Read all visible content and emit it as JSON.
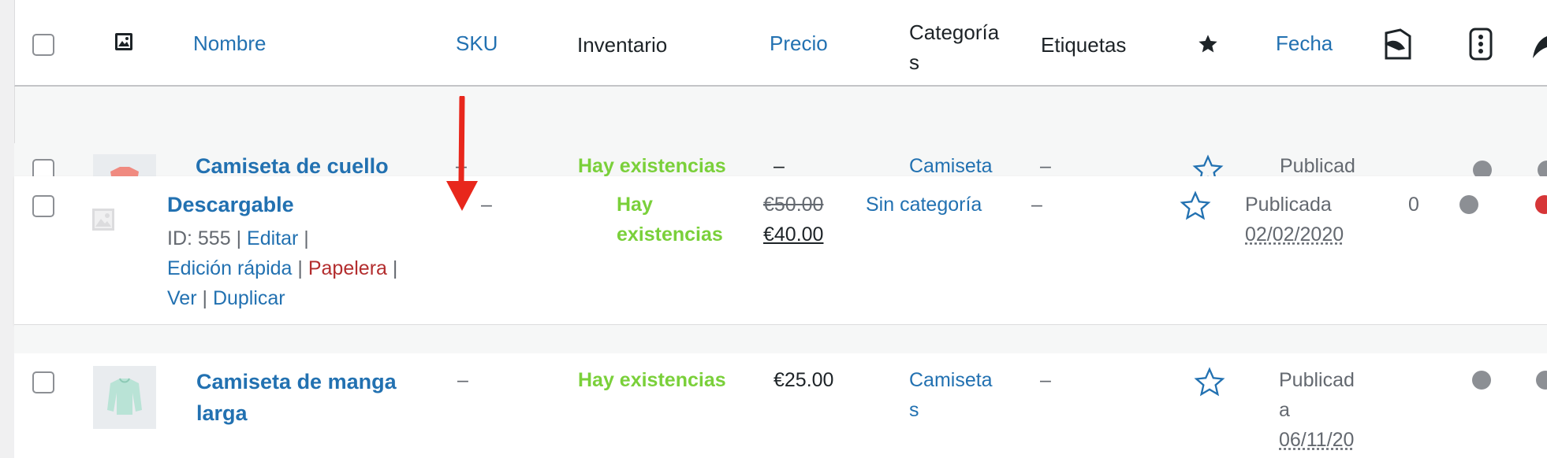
{
  "header": {
    "nombre": "Nombre",
    "sku": "SKU",
    "inventario": "Inventario",
    "precio": "Precio",
    "categorias_1": "Categoría",
    "categorias_2": "s",
    "etiquetas": "Etiquetas",
    "fecha": "Fecha"
  },
  "rows": [
    {
      "name": "Camiseta de cuello",
      "sku": "–",
      "stock": "Hay existencias",
      "price": "–",
      "category": "Camiseta",
      "tags": "–",
      "status": "Publicad"
    },
    {
      "name": "Descargable",
      "sku": "–",
      "stock_1": "Hay",
      "stock_2": "existencias",
      "price_old": "€50.00",
      "price_new": "€40.00",
      "category": "Sin categoría",
      "tags": "–",
      "status": "Publicada",
      "date": "02/02/2020",
      "count": "0",
      "id_label": "ID: 555",
      "sep": "|",
      "edit": "Editar",
      "quick_edit": "Edición rápida",
      "trash": "Papelera",
      "view": "Ver",
      "duplicate": "Duplicar"
    },
    {
      "name_1": "Camiseta de manga",
      "name_2": "larga",
      "sku": "–",
      "stock": "Hay existencias",
      "price": "€25.00",
      "category_1": "Camiseta",
      "category_2": "s",
      "tags": "–",
      "status_1": "Publicad",
      "status_2": "a",
      "date": "06/11/20"
    }
  ],
  "colors": {
    "link": "#2271b1",
    "in_stock": "#7ad03a",
    "trash": "#b32d2e",
    "annotation_arrow": "#e8271c"
  },
  "icons": [
    "image-icon",
    "star-icon",
    "file-icon",
    "type-icon",
    "leaf-icon",
    "star-outline-icon",
    "status-dot-icon",
    "placeholder-image-icon",
    "arrow-down-icon"
  ]
}
